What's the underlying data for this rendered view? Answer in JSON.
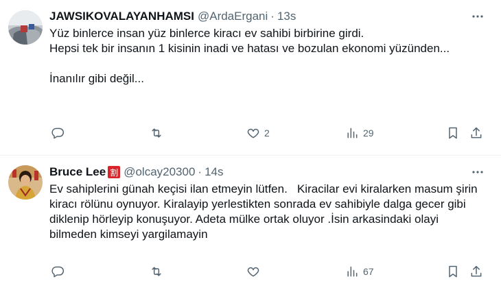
{
  "tweets": [
    {
      "display_name": "JAWSIKOVALAYANHAMSI",
      "handle": "@ArdaErgani",
      "separator": "·",
      "time": "13s",
      "text": "Yüz binlerce insan yüz binlerce kiracı ev sahibi birbirine girdi.\nHepsi tek bir insanın 1 kisinin inadi ve hatası ve bozulan ekonomi yüzünden...\n\nİnanılır gibi değil...",
      "reply_count": "",
      "retweet_count": "",
      "like_count": "2",
      "view_count": "29"
    },
    {
      "display_name": "Bruce Lee",
      "badge": "割",
      "handle": "@olcay20300",
      "separator": "·",
      "time": "14s",
      "text": "Ev sahiplerini günah keçisi ilan etmeyin lütfen.   Kiracilar evi kiralarken masum şirin kiracı rölünu oynuyor. Kiralayip yerlestikten sonrada ev sahibiyle dalga gecer gibi diklenip hörleyip konuşuyor. Adeta mülke ortak oluyor .İsin arkasindaki olayi bilmeden kimseyi yargilamayin",
      "reply_count": "",
      "retweet_count": "",
      "like_count": "",
      "view_count": "67"
    }
  ],
  "icons": {
    "reply": "reply-icon",
    "retweet": "retweet-icon",
    "like": "heart-icon",
    "views": "views-icon",
    "bookmark": "bookmark-icon",
    "share": "share-icon",
    "more": "more-icon"
  },
  "colors": {
    "text": "#0f1419",
    "secondary": "#536471",
    "divider": "#eff3f4",
    "badge": "#d8242a"
  }
}
